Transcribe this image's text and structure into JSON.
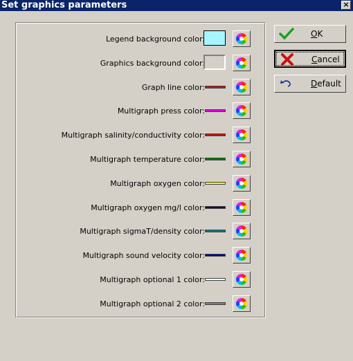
{
  "window": {
    "title": "Set graphics parameters",
    "close_glyph": "×"
  },
  "buttons": {
    "ok": {
      "mnemonic": "O",
      "rest": "K"
    },
    "cancel": {
      "mnemonic": "C",
      "rest": "ancel"
    },
    "default": {
      "mnemonic": "D",
      "rest": "efault"
    }
  },
  "settings": [
    {
      "label": "Legend background color:",
      "kind": "box",
      "color": "#a6f6ff"
    },
    {
      "label": "Graphics background color:",
      "kind": "box",
      "color": "#d4d0c8"
    },
    {
      "label": "Graph line color:",
      "kind": "line",
      "color": "#cc1010"
    },
    {
      "label": "Multigraph press color:",
      "kind": "line",
      "color": "#e000e0"
    },
    {
      "label": "Multigraph salinity/conductivity color:",
      "kind": "line",
      "color": "#cc1010"
    },
    {
      "label": "Multigraph temperature color:",
      "kind": "line",
      "color": "#008000"
    },
    {
      "label": "Multigraph oxygen color:",
      "kind": "line",
      "color": "#ffff00"
    },
    {
      "label": "Multigraph oxygen mg/l color:",
      "kind": "line",
      "color": "#101040"
    },
    {
      "label": "Multigraph sigmaT/density color:",
      "kind": "line",
      "color": "#008080"
    },
    {
      "label": "Multigraph sound velocity color:",
      "kind": "line",
      "color": "#0000b0"
    },
    {
      "label": "Multigraph optional 1 color:",
      "kind": "line",
      "color": "#ffffff"
    },
    {
      "label": "Multigraph optional 2 color:",
      "kind": "line",
      "color": "#808080"
    }
  ],
  "icons": {
    "picker": "color-wheel-icon",
    "ok": "checkmark-icon",
    "cancel": "x-icon",
    "default": "undo-arrow-icon"
  }
}
